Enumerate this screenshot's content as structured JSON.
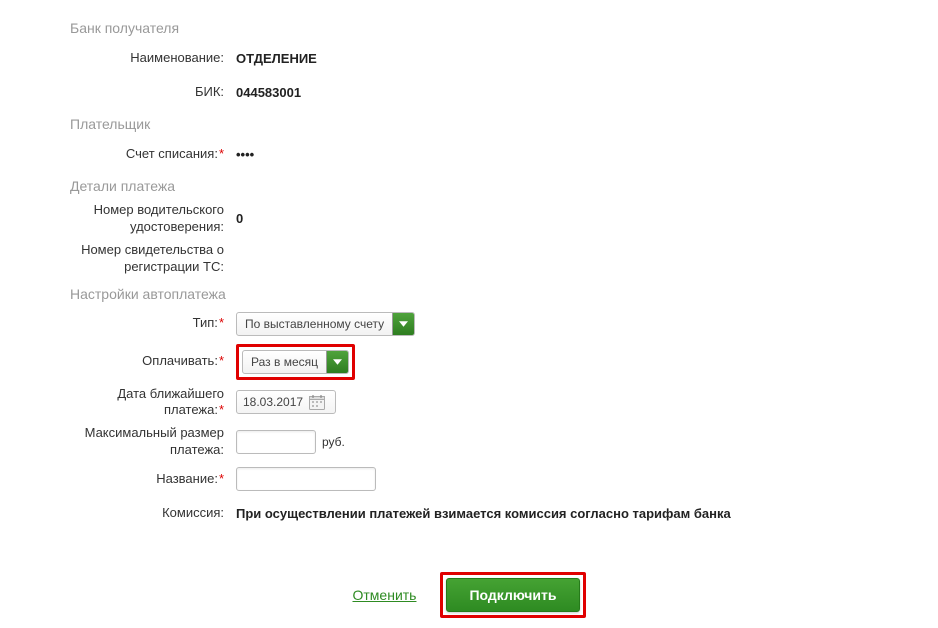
{
  "sections": {
    "recipient_bank": "Банк получателя",
    "payer": "Плательщик",
    "payment_details": "Детали платежа",
    "autopay_settings": "Настройки автоплатежа"
  },
  "labels": {
    "name": "Наименование:",
    "bik": "БИК:",
    "debit_account": "Счет списания:",
    "driver_license": "Номер водительского удостоверения:",
    "vehicle_reg": "Номер свидетельства о регистрации ТС:",
    "type": "Тип:",
    "pay_frequency": "Оплачивать:",
    "next_date": "Дата ближайшего платежа:",
    "max_amount": "Максимальный размер платежа:",
    "title": "Название:",
    "commission": "Комиссия:"
  },
  "values": {
    "name": "ОТДЕЛЕНИЕ",
    "bik": "044583001",
    "debit_account": "••••",
    "driver_license": "0",
    "vehicle_reg": "",
    "type_selected": "По выставленному счету",
    "pay_frequency_selected": "Раз в месяц",
    "next_date": "18.03.2017",
    "max_amount": "",
    "amount_unit": "руб.",
    "title": "",
    "commission": "При осуществлении платежей взимается комиссия согласно тарифам банка"
  },
  "actions": {
    "cancel": "Отменить",
    "submit": "Подключить"
  }
}
